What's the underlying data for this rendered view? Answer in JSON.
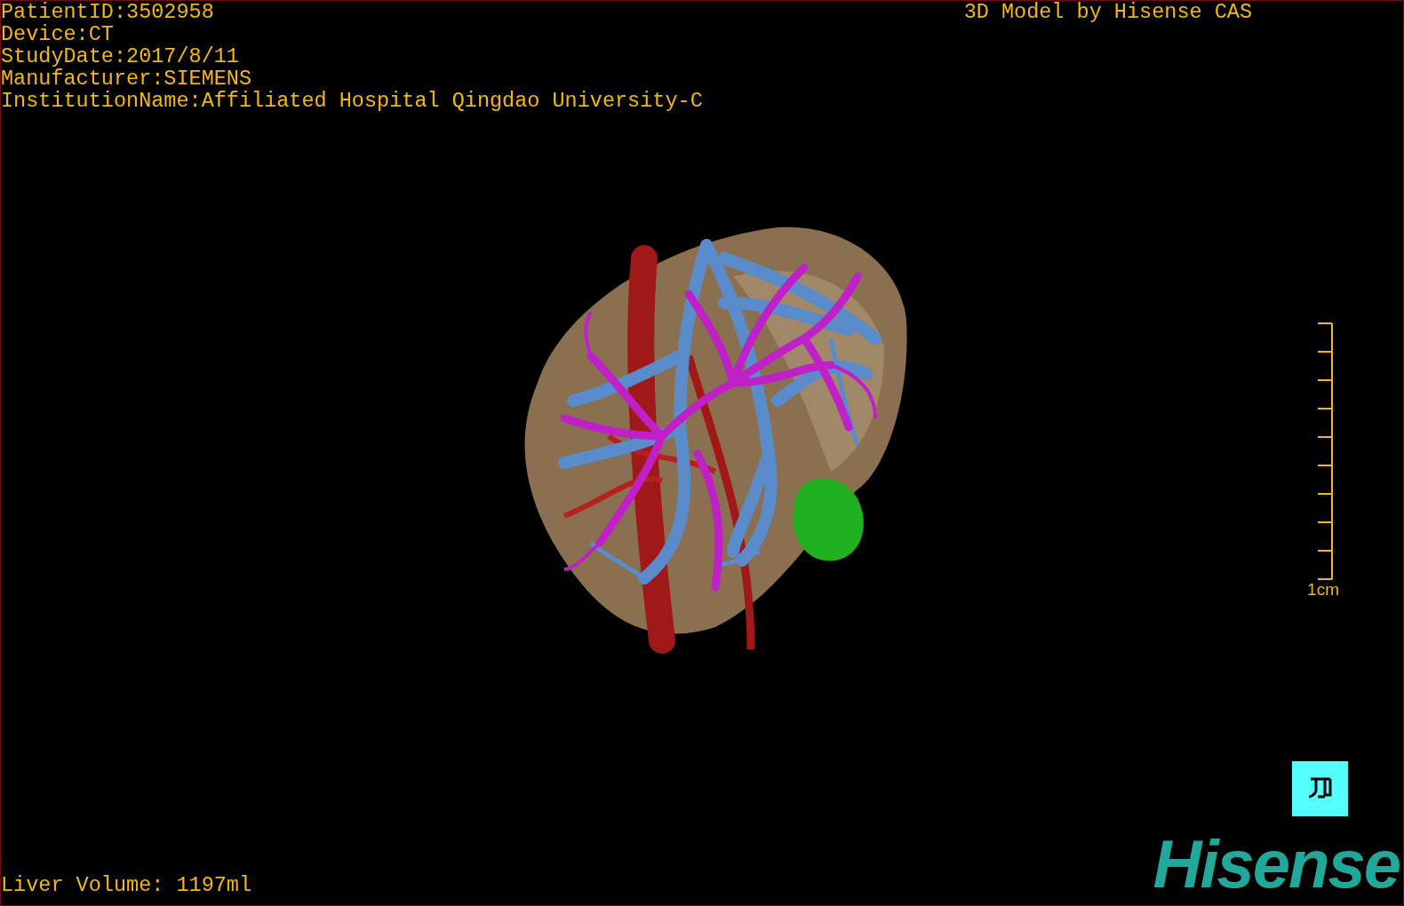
{
  "info_lines": [
    "PatientID:3502958",
    "Device:CT",
    "StudyDate:2017/8/11",
    "Manufacturer:SIEMENS",
    "InstitutionName:Affiliated Hospital Qingdao University-C"
  ],
  "title": "3D Model by Hisense CAS",
  "scale": {
    "label": "1cm"
  },
  "liver_volume": "Liver Volume: 1197ml",
  "logo": "Hisense"
}
